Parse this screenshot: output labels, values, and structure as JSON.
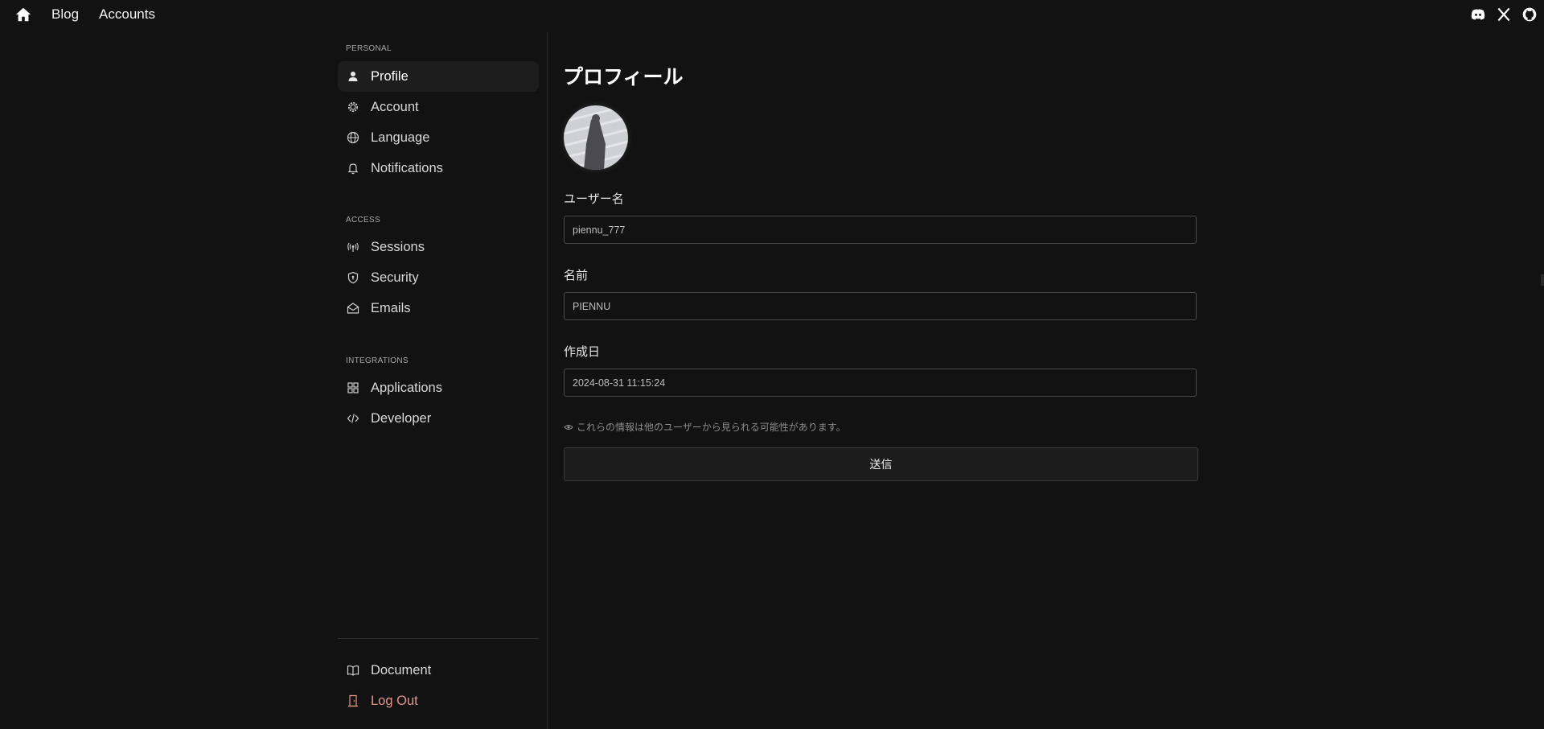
{
  "topnav": {
    "links": [
      "Blog",
      "Accounts"
    ],
    "social_icons": [
      "discord-icon",
      "x-icon",
      "github-icon"
    ]
  },
  "sidebar": {
    "sections": [
      {
        "title": "PERSONAL",
        "items": [
          {
            "label": "Profile",
            "icon": "user-icon",
            "active": true
          },
          {
            "label": "Account",
            "icon": "gear-icon"
          },
          {
            "label": "Language",
            "icon": "globe-icon"
          },
          {
            "label": "Notifications",
            "icon": "bell-icon"
          }
        ]
      },
      {
        "title": "ACCESS",
        "items": [
          {
            "label": "Sessions",
            "icon": "broadcast-icon"
          },
          {
            "label": "Security",
            "icon": "shield-icon"
          },
          {
            "label": "Emails",
            "icon": "mail-icon"
          }
        ]
      },
      {
        "title": "INTEGRATIONS",
        "items": [
          {
            "label": "Applications",
            "icon": "grid-icon"
          },
          {
            "label": "Developer",
            "icon": "code-icon"
          }
        ]
      }
    ],
    "footer": [
      {
        "label": "Document",
        "icon": "book-icon"
      },
      {
        "label": "Log Out",
        "icon": "logout-icon",
        "color": "#e8928c"
      }
    ]
  },
  "main": {
    "title": "プロフィール",
    "fields": [
      {
        "label": "ユーザー名",
        "value": "piennu_777"
      },
      {
        "label": "名前",
        "value": "PIENNU"
      },
      {
        "label": "作成日",
        "value": "2024-08-31 11:15:24"
      }
    ],
    "notice": "これらの情報は他のユーザーから見られる可能性があります。",
    "submit_label": "送信"
  },
  "colors": {
    "background": "#121212",
    "logout": "#e8928c",
    "active_item_bg": "#1d1d1d"
  }
}
